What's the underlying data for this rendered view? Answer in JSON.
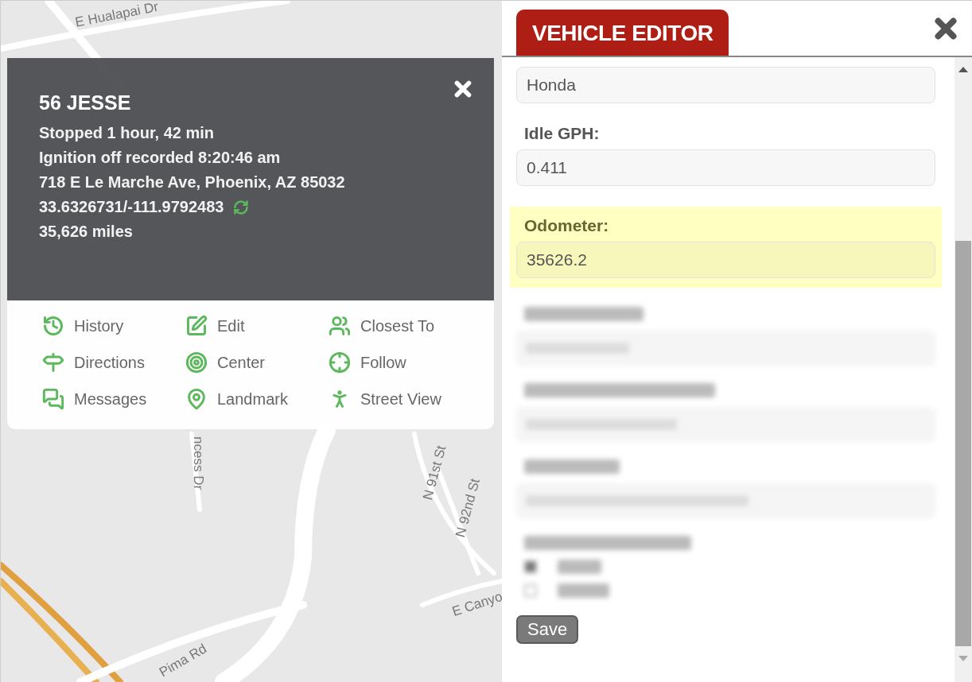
{
  "map": {
    "street_labels": [
      "E Hualapai Dr",
      "ncess Dr",
      "N 91st St",
      "N 92nd St",
      "E Canyo",
      "Pima Rd"
    ]
  },
  "popup": {
    "title": "56 JESSE",
    "lines": [
      "Stopped 1 hour, 42 min",
      "Ignition off recorded 8:20:46 am",
      "718 E Le Marche Ave, Phoenix, AZ 85032"
    ],
    "coordinates": "33.6326731/-111.9792483",
    "mileage": "35,626 miles",
    "actions": [
      {
        "label": "History"
      },
      {
        "label": "Edit"
      },
      {
        "label": "Closest To"
      },
      {
        "label": "Directions"
      },
      {
        "label": "Center"
      },
      {
        "label": "Follow"
      },
      {
        "label": "Messages"
      },
      {
        "label": "Landmark"
      },
      {
        "label": "Street View"
      }
    ]
  },
  "editor": {
    "tab": "VEHICLE EDITOR",
    "fields": [
      {
        "value": "Honda",
        "highlighted": false
      },
      {
        "label": "Idle GPH:",
        "value": "0.411",
        "highlighted": false
      },
      {
        "label": "Odometer:",
        "value": "35626.2",
        "highlighted": true
      }
    ],
    "redacted": [
      {
        "kind": "field"
      },
      {
        "kind": "field"
      },
      {
        "kind": "field"
      },
      {
        "kind": "checklist",
        "options": [
          {
            "checked": true
          },
          {
            "checked": false
          }
        ]
      }
    ],
    "save": "Save"
  }
}
